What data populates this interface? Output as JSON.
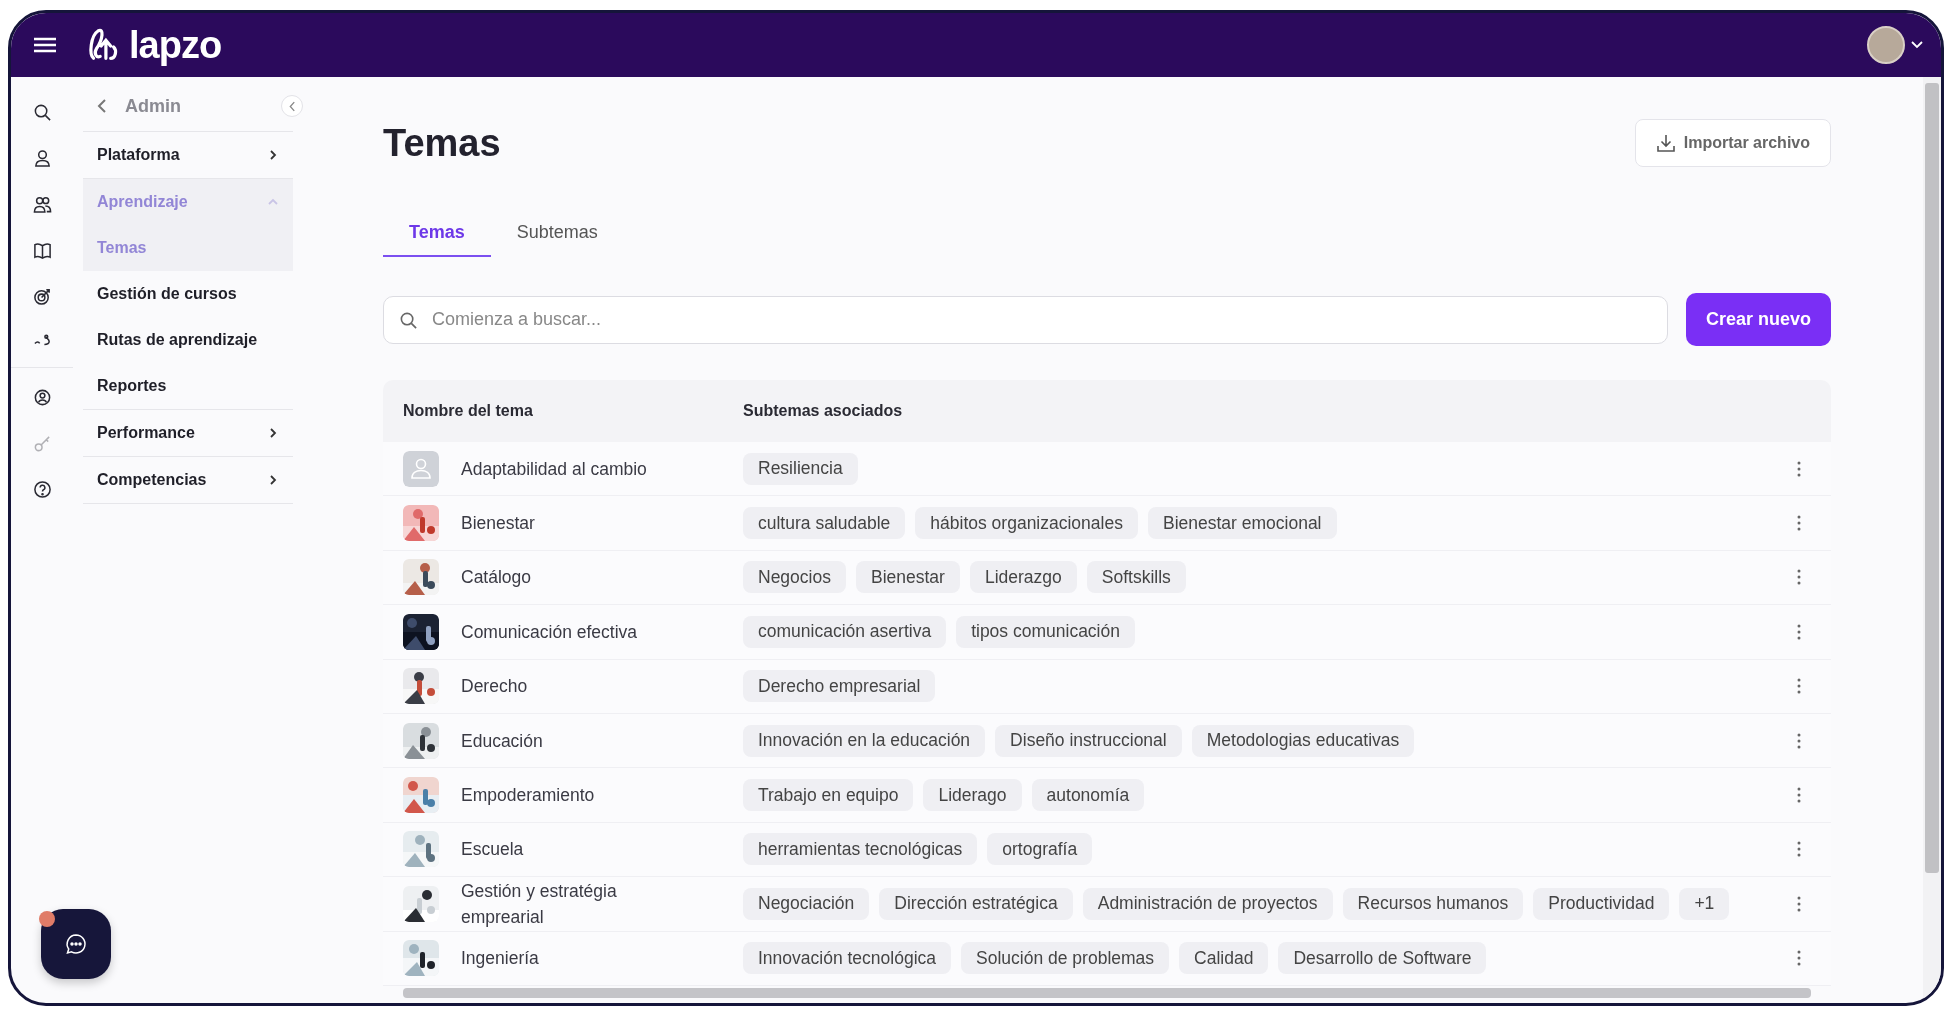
{
  "topbar": {
    "logo": "lapzo"
  },
  "sidebar": {
    "back_label": "Admin",
    "items": [
      {
        "label": "Plataforma",
        "expanded": false,
        "selected": false
      },
      {
        "label": "Aprendizaje",
        "expanded": true,
        "selected": true,
        "children": [
          {
            "label": "Temas",
            "selected": true
          },
          {
            "label": "Gestión de cursos",
            "selected": false
          },
          {
            "label": "Rutas de aprendizaje",
            "selected": false
          },
          {
            "label": "Reportes",
            "selected": false
          }
        ]
      },
      {
        "label": "Performance",
        "expanded": false,
        "selected": false
      },
      {
        "label": "Competencias",
        "expanded": false,
        "selected": false
      }
    ]
  },
  "page": {
    "title": "Temas",
    "import_button": "Importar archivo",
    "tabs": [
      {
        "label": "Temas",
        "selected": true
      },
      {
        "label": "Subtemas",
        "selected": false
      }
    ],
    "search": {
      "placeholder": "Comienza a buscar..."
    },
    "create_button": "Crear nuevo"
  },
  "table": {
    "columns": [
      "Nombre del tema",
      "Subtemas asociados"
    ],
    "rows": [
      {
        "name": "Adaptabilidad al cambio",
        "thumb": {
          "kind": "placeholder"
        },
        "subtopics": [
          "Resiliencia"
        ]
      },
      {
        "name": "Bienestar",
        "thumb": {
          "kind": "picture"
        },
        "subtopics": [
          "cultura saludable",
          "hábitos organizacionales",
          "Bienestar emocional"
        ]
      },
      {
        "name": "Catálogo",
        "thumb": {
          "kind": "picture"
        },
        "subtopics": [
          "Negocios",
          "Bienestar",
          "Liderazgo",
          "Softskills"
        ]
      },
      {
        "name": "Comunicación efectiva",
        "thumb": {
          "kind": "picture"
        },
        "subtopics": [
          "comunicación asertiva",
          "tipos comunicación"
        ]
      },
      {
        "name": "Derecho",
        "thumb": {
          "kind": "picture"
        },
        "subtopics": [
          "Derecho empresarial"
        ]
      },
      {
        "name": "Educación",
        "thumb": {
          "kind": "picture"
        },
        "subtopics": [
          "Innovación en la educación",
          "Diseño instruccional",
          "Metodologias educativas"
        ]
      },
      {
        "name": "Empoderamiento",
        "thumb": {
          "kind": "picture"
        },
        "subtopics": [
          "Trabajo en equipo",
          "Liderago",
          "autonomía"
        ]
      },
      {
        "name": "Escuela",
        "thumb": {
          "kind": "picture"
        },
        "subtopics": [
          "herramientas tecnológicas",
          "ortografía"
        ]
      },
      {
        "name": "Gestión y estratégia emprearial",
        "thumb": {
          "kind": "picture"
        },
        "subtopics": [
          "Negociación",
          "Dirección estratégica",
          "Administración de proyectos",
          "Recursos humanos",
          "Productividad"
        ],
        "more": "+1"
      },
      {
        "name": "Ingeniería",
        "thumb": {
          "kind": "picture"
        },
        "subtopics": [
          "Innovación tecnológica",
          "Solución de problemas",
          "Calidad",
          "Desarrollo de Software"
        ]
      }
    ]
  },
  "chat": {
    "unread": true
  }
}
